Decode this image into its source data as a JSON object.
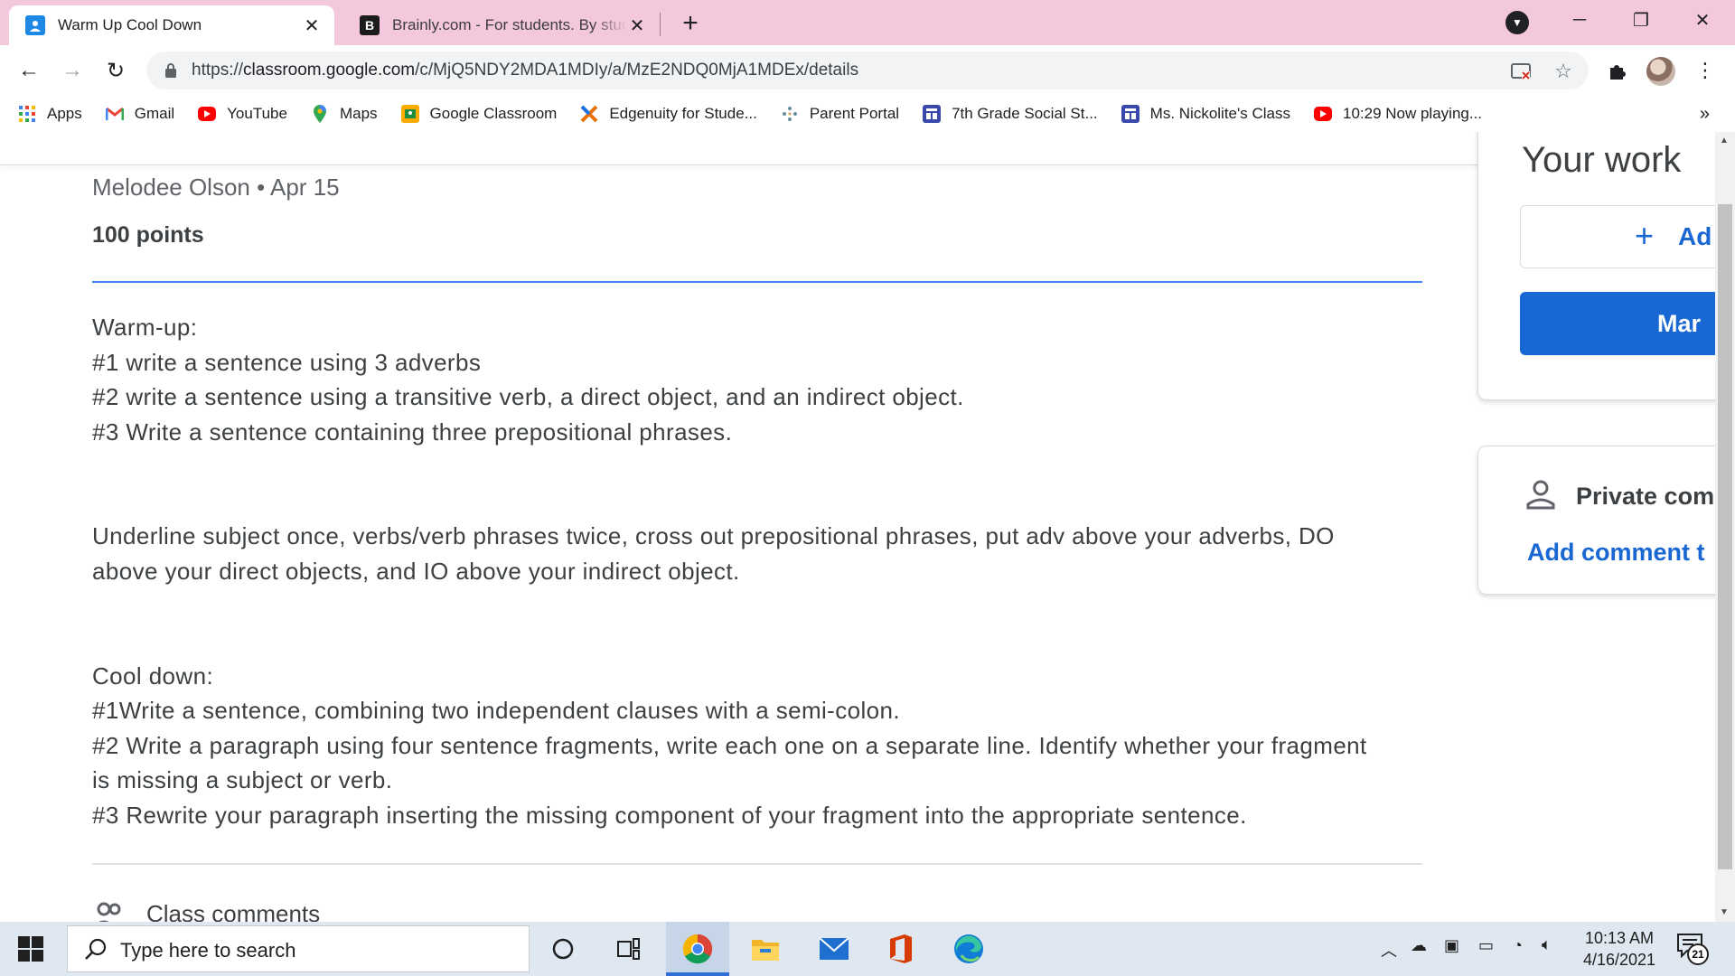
{
  "tabs": [
    {
      "title": "Warm Up Cool Down",
      "active": true
    },
    {
      "title": "Brainly.com - For students. By students.",
      "active": false
    }
  ],
  "address_bar": {
    "scheme": "https://",
    "host": "classroom.google.com",
    "path": "/c/MjQ5NDY2MDA1MDIy/a/MzE2NDQ0MjA1MDEx/details"
  },
  "bookmarks": [
    {
      "label": "Apps",
      "icon": "apps-grid-icon"
    },
    {
      "label": "Gmail",
      "icon": "gmail-icon"
    },
    {
      "label": "YouTube",
      "icon": "youtube-icon"
    },
    {
      "label": "Maps",
      "icon": "maps-icon"
    },
    {
      "label": "Google Classroom",
      "icon": "classroom-icon"
    },
    {
      "label": "Edgenuity for Stude...",
      "icon": "edgenuity-icon"
    },
    {
      "label": "Parent Portal",
      "icon": "parent-portal-icon"
    },
    {
      "label": "7th Grade Social St...",
      "icon": "sites-icon"
    },
    {
      "label": "Ms. Nickolite's Class",
      "icon": "sites-icon"
    },
    {
      "label": "10:29 Now playing...",
      "icon": "youtube-icon"
    }
  ],
  "assignment": {
    "meta": "Melodee Olson • Apr 15",
    "points": "100 points",
    "description": {
      "warmup_heading": "Warm-up:",
      "warmup_1": "#1 write a sentence using 3 adverbs",
      "warmup_2": "#2 write a sentence using a transitive verb, a direct object, and an indirect object.",
      "warmup_3": "#3 Write a sentence containing three prepositional phrases.",
      "instructions_1": "Underline subject once, verbs/verb phrases twice, cross out prepositional phrases, put adv above your adverbs, DO",
      "instructions_2": "above your direct objects, and IO above your indirect object.",
      "cooldown_heading": "Cool down:",
      "cooldown_1": "#1Write a sentence, combining two independent clauses with a semi-colon.",
      "cooldown_2a": "#2 Write a paragraph using four sentence fragments, write each one on a separate line.  Identify whether your fragment",
      "cooldown_2b": "is missing a subject or verb.",
      "cooldown_3": "#3 Rewrite your paragraph inserting the missing component of your fragment into the appropriate sentence."
    },
    "class_comments_label": "Class comments"
  },
  "your_work": {
    "title": "Your work",
    "add_label": "Ad",
    "mark_label": "Mar"
  },
  "private_comments": {
    "title": "Private com",
    "add_label": "Add comment t"
  },
  "taskbar": {
    "search_placeholder": "Type here to search",
    "time": "10:13 AM",
    "date": "4/16/2021",
    "notification_count": "21"
  },
  "colors": {
    "tab_strip": "#f4c8dc",
    "accent_blue": "#1967d2",
    "divider_blue": "#4285f4"
  }
}
